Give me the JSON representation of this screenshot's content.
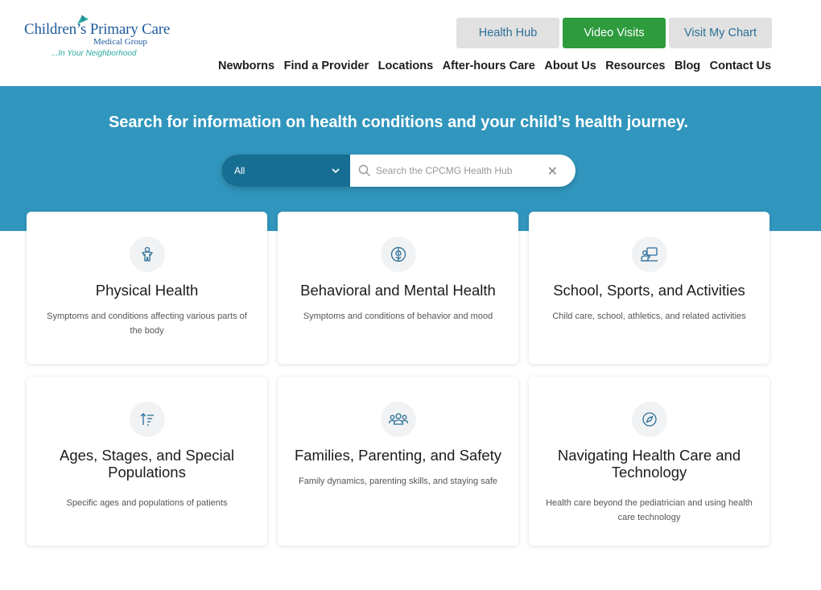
{
  "logo": {
    "title": "Children’s Primary Care",
    "subtitle": "Medical Group",
    "tagline": "...In Your Neighborhood"
  },
  "top_buttons": {
    "health_hub": "Health Hub",
    "video_visits": "Video Visits",
    "visit_my_chart": "Visit My Chart"
  },
  "nav": [
    "Newborns",
    "Find a Provider",
    "Locations",
    "After-hours Care",
    "About Us",
    "Resources",
    "Blog",
    "Contact Us"
  ],
  "hero": {
    "title": "Search for information on health conditions and your child’s health journey."
  },
  "search": {
    "category": "All",
    "placeholder": "Search the CPCMG Health Hub",
    "value": ""
  },
  "cards": [
    {
      "title": "Physical Health",
      "desc": "Symptoms and conditions affecting various parts of the body",
      "icon": "body-icon"
    },
    {
      "title": "Behavioral and Mental Health",
      "desc": "Symptoms and conditions of behavior and mood",
      "icon": "brain-icon"
    },
    {
      "title": "School, Sports, and Activities",
      "desc": "Child care, school, athletics, and related activities",
      "icon": "classroom-icon"
    },
    {
      "title": "Ages, Stages, and Special Populations",
      "desc": "Specific ages and populations of patients",
      "icon": "sort-ascending-icon"
    },
    {
      "title": "Families, Parenting, and Safety",
      "desc": "Family dynamics, parenting skills, and staying safe",
      "icon": "group-icon"
    },
    {
      "title": "Navigating Health Care and Technology",
      "desc": "Health care beyond the pediatrician and using health care technology",
      "icon": "compass-icon"
    }
  ],
  "colors": {
    "hero_bg": "#3196bd",
    "select_bg": "#166e93",
    "video_green": "#2e9b3d",
    "icon_stroke": "#2b6f97"
  }
}
